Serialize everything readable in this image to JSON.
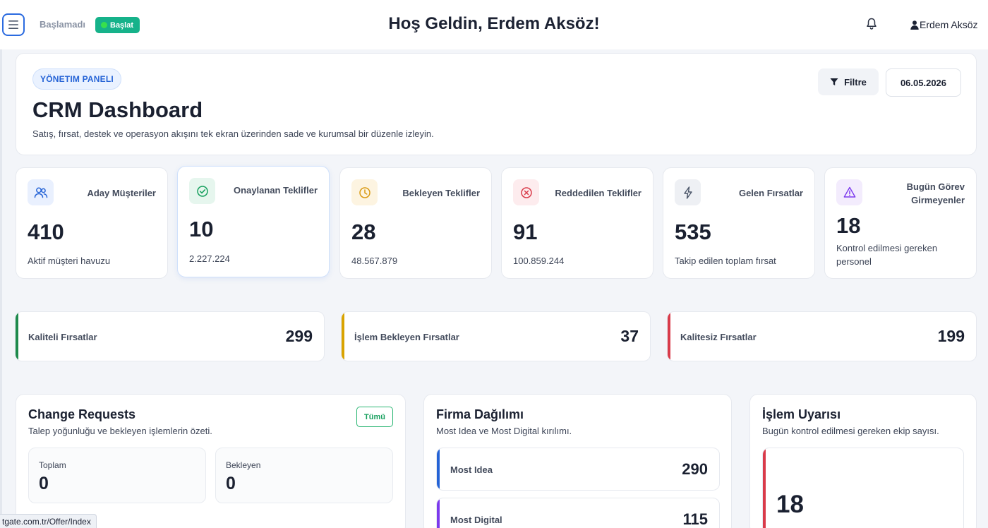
{
  "header": {
    "status_text": "Başlamadı",
    "start_label": "Başlat",
    "welcome": "Hoş Geldin, Erdem Aksöz!",
    "user_name": "Erdem Aksöz"
  },
  "hero": {
    "badge": "YÖNETIM PANELI",
    "title": "CRM Dashboard",
    "subtitle": "Satış, fırsat, destek ve operasyon akışını tek ekran üzerinden sade ve kurumsal bir düzenle izleyin.",
    "filter_label": "Filtre",
    "date": "06.05.2026"
  },
  "stats": [
    {
      "label": "Aday Müşteriler",
      "value": "410",
      "desc": "Aktif müşteri havuzu",
      "icon": "users-icon",
      "color": "#2563d6"
    },
    {
      "label": "Onaylanan Teklifler",
      "value": "10",
      "desc": "2.227.224",
      "icon": "check-circle-icon",
      "color": "#17a05e"
    },
    {
      "label": "Bekleyen Teklifler",
      "value": "28",
      "desc": "48.567.879",
      "icon": "clock-icon",
      "color": "#d99a13"
    },
    {
      "label": "Reddedilen Teklifler",
      "value": "91",
      "desc": "100.859.244",
      "icon": "x-circle-icon",
      "color": "#d93b4a"
    },
    {
      "label": "Gelen Fırsatlar",
      "value": "535",
      "desc": "Takip edilen toplam fırsat",
      "icon": "lightning-icon",
      "color": "#4a5568"
    },
    {
      "label": "Bugün Görev Girmeyenler",
      "value": "18",
      "desc": "Kontrol edilmesi gereken personel",
      "icon": "warning-icon",
      "color": "#7c3aed"
    }
  ],
  "opportunities": [
    {
      "label": "Kaliteli Fırsatlar",
      "value": "299",
      "color": "#1e8a4c"
    },
    {
      "label": "İşlem Bekleyen Fırsatlar",
      "value": "37",
      "color": "#d9a300"
    },
    {
      "label": "Kalitesiz Fırsatlar",
      "value": "199",
      "color": "#d93b4a"
    }
  ],
  "change_requests": {
    "title": "Change Requests",
    "subtitle": "Talep yoğunluğu ve bekleyen işlemlerin özeti.",
    "all_label": "Tümü",
    "total_label": "Toplam",
    "total_value": "0",
    "pending_label": "Bekleyen",
    "pending_value": "0"
  },
  "firm_distribution": {
    "title": "Firma Dağılımı",
    "subtitle": "Most Idea ve Most Digital kırılımı.",
    "items": [
      {
        "label": "Most Idea",
        "value": "290",
        "color": "#2563d6"
      },
      {
        "label": "Most Digital",
        "value": "115",
        "color": "#7c3aed"
      }
    ]
  },
  "warning": {
    "title": "İşlem Uyarısı",
    "subtitle": "Bugün kontrol edilmesi gereken ekip sayısı.",
    "value": "18"
  },
  "status_bar": {
    "url": "tgate.com.tr/Offer/Index"
  }
}
